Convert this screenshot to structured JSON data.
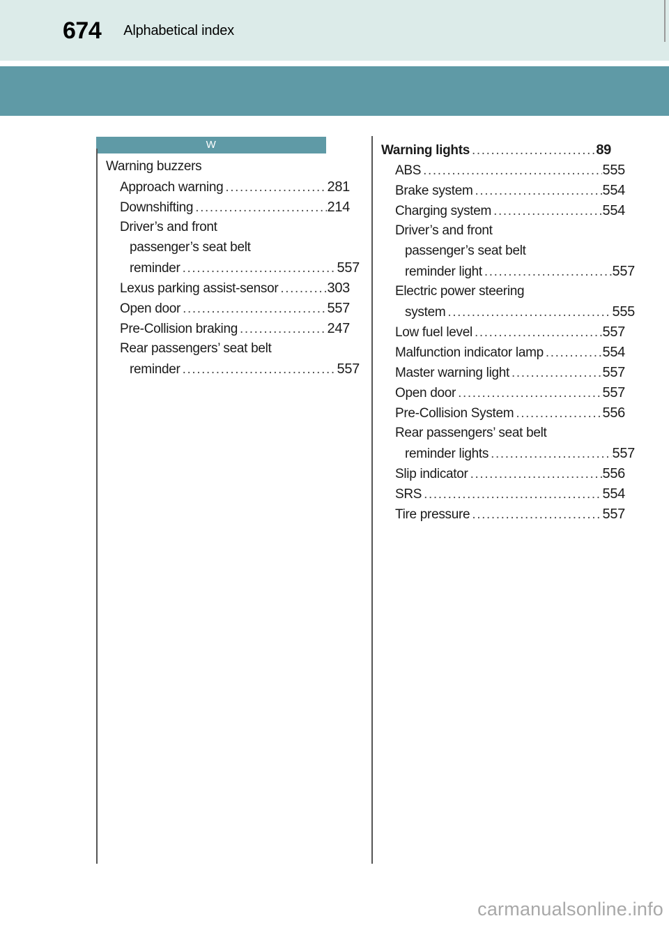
{
  "header": {
    "page_number": "674",
    "title": "Alphabetical index",
    "band_color": "#dcebe9",
    "accent_color": "#5f9aa6"
  },
  "left_column": {
    "letter_bar": "W",
    "entries": [
      {
        "level": 0,
        "label": "Warning buzzers",
        "leader": "",
        "page": "",
        "bold": false,
        "no_leader": true
      },
      {
        "level": 1,
        "label": "Approach warning",
        "leader": "............................................................",
        "page": "281",
        "bold": false,
        "no_leader": false
      },
      {
        "level": 1,
        "label": "Downshifting",
        "leader": "............................................................",
        "page": "214",
        "bold": false,
        "no_leader": false
      },
      {
        "level": 1,
        "label": "Driver’s and front",
        "leader": "",
        "page": "",
        "bold": false,
        "no_leader": true
      },
      {
        "level": 2,
        "label": "passenger’s seat belt",
        "leader": "",
        "page": "",
        "bold": false,
        "no_leader": true
      },
      {
        "level": 2,
        "label": "reminder",
        "leader": "............................................................",
        "page": "557",
        "bold": false,
        "no_leader": false
      },
      {
        "level": 1,
        "label": "Lexus parking assist-sensor",
        "leader": "............................................................",
        "page": "303",
        "bold": false,
        "no_leader": false
      },
      {
        "level": 1,
        "label": "Open door",
        "leader": "............................................................",
        "page": "557",
        "bold": false,
        "no_leader": false
      },
      {
        "level": 1,
        "label": "Pre-Collision braking",
        "leader": "............................................................",
        "page": "247",
        "bold": false,
        "no_leader": false
      },
      {
        "level": 1,
        "label": "Rear passengers’ seat belt",
        "leader": "",
        "page": "",
        "bold": false,
        "no_leader": true
      },
      {
        "level": 2,
        "label": "reminder",
        "leader": "............................................................",
        "page": "557",
        "bold": false,
        "no_leader": false
      }
    ]
  },
  "right_column": {
    "letter_bar": "",
    "entries": [
      {
        "level": 0,
        "label": "Warning lights",
        "leader": "............................................................",
        "page": "89",
        "bold": true,
        "no_leader": false
      },
      {
        "level": 1,
        "label": "ABS",
        "leader": "............................................................",
        "page": "555",
        "bold": false,
        "no_leader": false
      },
      {
        "level": 1,
        "label": "Brake system",
        "leader": "............................................................",
        "page": "554",
        "bold": false,
        "no_leader": false
      },
      {
        "level": 1,
        "label": "Charging system",
        "leader": "............................................................",
        "page": "554",
        "bold": false,
        "no_leader": false
      },
      {
        "level": 1,
        "label": "Driver’s and front",
        "leader": "",
        "page": "",
        "bold": false,
        "no_leader": true
      },
      {
        "level": 2,
        "label": "passenger’s seat belt",
        "leader": "",
        "page": "",
        "bold": false,
        "no_leader": true
      },
      {
        "level": 2,
        "label": "reminder light",
        "leader": "............................................................",
        "page": "557",
        "bold": false,
        "no_leader": false
      },
      {
        "level": 1,
        "label": "Electric power steering",
        "leader": "",
        "page": "",
        "bold": false,
        "no_leader": true
      },
      {
        "level": 2,
        "label": "system",
        "leader": "............................................................",
        "page": "555",
        "bold": false,
        "no_leader": false
      },
      {
        "level": 1,
        "label": "Low fuel level",
        "leader": "............................................................",
        "page": "557",
        "bold": false,
        "no_leader": false
      },
      {
        "level": 1,
        "label": "Malfunction indicator lamp",
        "leader": "............................................................",
        "page": "554",
        "bold": false,
        "no_leader": false
      },
      {
        "level": 1,
        "label": "Master warning light",
        "leader": "............................................................",
        "page": "557",
        "bold": false,
        "no_leader": false
      },
      {
        "level": 1,
        "label": "Open door",
        "leader": "............................................................",
        "page": "557",
        "bold": false,
        "no_leader": false
      },
      {
        "level": 1,
        "label": "Pre-Collision System",
        "leader": "............................................................",
        "page": "556",
        "bold": false,
        "no_leader": false
      },
      {
        "level": 1,
        "label": "Rear passengers’ seat belt",
        "leader": "",
        "page": "",
        "bold": false,
        "no_leader": true
      },
      {
        "level": 2,
        "label": "reminder lights",
        "leader": "............................................................",
        "page": "557",
        "bold": false,
        "no_leader": false
      },
      {
        "level": 1,
        "label": "Slip indicator",
        "leader": "............................................................",
        "page": "556",
        "bold": false,
        "no_leader": false
      },
      {
        "level": 1,
        "label": "SRS",
        "leader": "............................................................",
        "page": "554",
        "bold": false,
        "no_leader": false
      },
      {
        "level": 1,
        "label": "Tire pressure",
        "leader": "............................................................",
        "page": "557",
        "bold": false,
        "no_leader": false
      }
    ]
  },
  "watermark": "carmanualsonline.info"
}
